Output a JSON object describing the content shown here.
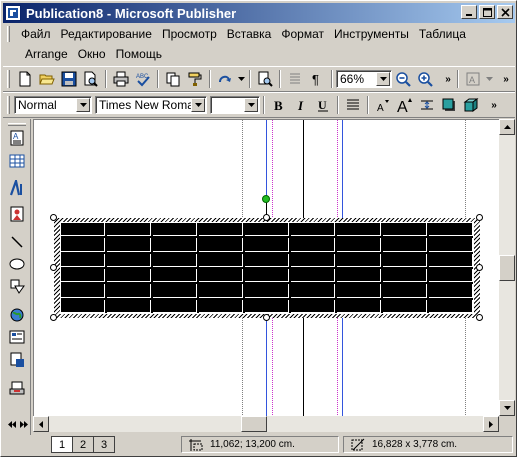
{
  "window": {
    "title": "Publication8 - Microsoft Publisher",
    "minimize_icon": "minimize-icon",
    "maximize_icon": "maximize-icon",
    "close_icon": "close-icon"
  },
  "menu": {
    "items": [
      "Файл",
      "Редактирование",
      "Просмотр",
      "Вставка",
      "Формат",
      "Инструменты",
      "Таблица",
      "Arrange",
      "Окно",
      "Помощь"
    ]
  },
  "toolbar_standard": {
    "zoom": "66%"
  },
  "toolbar_format": {
    "style": "Normal",
    "font": "Times New Roman",
    "size": ""
  },
  "status": {
    "pages": [
      "1",
      "2",
      "3"
    ],
    "active_page": "1",
    "position": "11,062; 13,200 cm.",
    "size": "16,828 x   3,778 cm."
  },
  "colors": {
    "titlebar_start": "#0a246a",
    "titlebar_end": "#a6caf0",
    "chrome": "#d4d0c8",
    "guide_blue": "#3355dd",
    "guide_pink": "#cc33cc",
    "rotation_handle": "#22bb22"
  }
}
